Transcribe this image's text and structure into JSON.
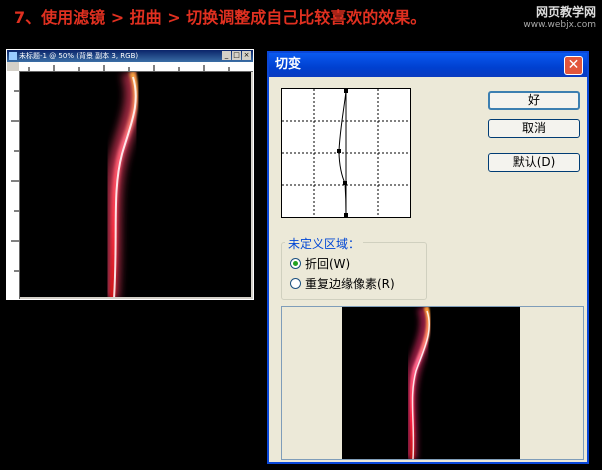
{
  "instruction": "7、使用滤镜 > 扭曲 > 切换调整成自己比较喜欢的效果。",
  "watermark": {
    "main": "网页教学网",
    "sub": "www.webjx.com"
  },
  "document_window": {
    "title": "未标题-1 @ 50% (背景 副本 3, RGB)"
  },
  "dialog": {
    "title": "切变",
    "close_glyph": "✕",
    "buttons": {
      "ok": "好",
      "cancel": "取消",
      "default": "默认(D)"
    },
    "undefined_area": {
      "label": "未定义区域：",
      "options": [
        {
          "label": "折回(W)",
          "selected": true
        },
        {
          "label": "重复边缘像素(R)",
          "selected": false
        }
      ]
    }
  },
  "colors": {
    "accent": "#0a47d8",
    "instruction_text": "#e03020",
    "flame_core": "#ff4040"
  }
}
